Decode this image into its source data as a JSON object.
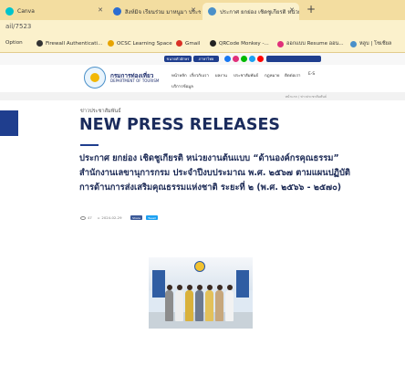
{
  "browser": {
    "tabs": [
      {
        "label": "Canva",
        "active": false,
        "icon_color": "#00c4cc"
      },
      {
        "label": "สิงห์มิจ เรียนร่วม มาหนูมา ประชากนิ..",
        "active": false,
        "icon_color": "#2b6cd2"
      },
      {
        "label": "ประกาศ ยกย่อง เชิดชูเกียรติ หน่วยงาน",
        "active": true,
        "icon_color": "#4a90c9"
      }
    ],
    "new_tab_label": "+",
    "address": "ail/7523",
    "bookmarks": [
      {
        "label": "Option",
        "icon_color": "#999999"
      },
      {
        "label": "Firewall Authenticati...",
        "icon_color": "#333333"
      },
      {
        "label": "OCSC Learning Space",
        "icon_color": "#e7a400"
      },
      {
        "label": "Gmail",
        "icon_color": "#d93025"
      },
      {
        "label": "QRCode Monkey -...",
        "icon_color": "#222222"
      },
      {
        "label": "ออกแบบ Resume ออน...",
        "icon_color": "#e0307a"
      },
      {
        "label": "หลูบ | โซเชียล",
        "icon_color": "#4a90c9"
      }
    ]
  },
  "site": {
    "topbar": {
      "pills": [
        "ขนาดตัวอักษร",
        "ภาษาไทย"
      ],
      "circles": [
        "#1877f2",
        "#e0307a",
        "#00b900",
        "#1da1f2",
        "#ff0000"
      ]
    },
    "logo": {
      "title": "กรมการท่องเที่ยว",
      "subtitle": "DEPARTMENT OF TOURISM"
    },
    "nav": [
      "หน้าหลัก",
      "เกี่ยวกับเรา",
      "ผลงาน",
      "ประชาสัมพันธ์",
      "กฎหมาย",
      "ติดต่อเรา",
      "E-S"
    ],
    "nav_row2": "บริการข้อมูล",
    "breadcrumb": "หน้าแรก  /  ข่าวประชาสัมพันธ์"
  },
  "article": {
    "category": "ข่าวประชาสัมพันธ์",
    "title": "NEW PRESS RELEASES",
    "headline": "ประกาศ ยกย่อง เชิดชูเกียรติ หน่วยงานต้นแบบ “ด้านองค์กรคุณธรรม” สำนักงานเลขานุการกรม ประจำปีงบประมาณ พ.ศ. ๒๕๖๗ ตามแผนปฏิบัติการด้านการส่งเสริมคุณธรรมแห่งชาติ ระยะที่ ๒ (พ.ศ. ๒๕๖๖ - ๒๕๗๐)",
    "views": "47",
    "date": "2024-02-29",
    "share_buttons": [
      {
        "label": "Share",
        "color": "#3b5998"
      },
      {
        "label": "Tweet",
        "color": "#1da1f2"
      }
    ],
    "photo_alt": "รูปหมู่เจ้าหน้าที่"
  }
}
